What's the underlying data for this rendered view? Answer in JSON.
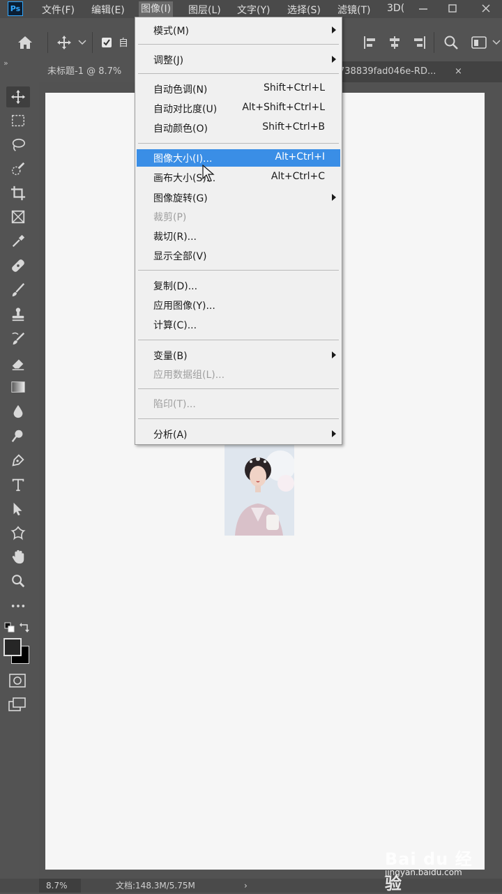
{
  "app": {
    "logo": "Ps"
  },
  "menubar": {
    "items": [
      "文件(F)",
      "编辑(E)",
      "图像(I)",
      "图层(L)",
      "文字(Y)",
      "选择(S)",
      "滤镜(T)",
      "3D("
    ],
    "active_index": 2
  },
  "optionsbar": {
    "auto_select_label": "自"
  },
  "tabs": [
    {
      "label": "未标题-1 @ 8.7%",
      "active": true
    },
    {
      "label": "738839fad046e-RD...",
      "active": false,
      "close": "×"
    }
  ],
  "image_menu": {
    "items": [
      {
        "label": "模式(M)",
        "shortcut": "",
        "submenu": true,
        "disabled": false
      },
      {
        "label": "调整(J)",
        "shortcut": "",
        "submenu": true,
        "disabled": false
      },
      {
        "label": "自动色调(N)",
        "shortcut": "Shift+Ctrl+L",
        "submenu": false,
        "disabled": false
      },
      {
        "label": "自动对比度(U)",
        "shortcut": "Alt+Shift+Ctrl+L",
        "submenu": false,
        "disabled": false
      },
      {
        "label": "自动颜色(O)",
        "shortcut": "Shift+Ctrl+B",
        "submenu": false,
        "disabled": false
      },
      {
        "label": "图像大小(I)...",
        "shortcut": "Alt+Ctrl+I",
        "submenu": false,
        "disabled": false,
        "highlighted": true
      },
      {
        "label": "画布大小(S)...",
        "shortcut": "Alt+Ctrl+C",
        "submenu": false,
        "disabled": false
      },
      {
        "label": "图像旋转(G)",
        "shortcut": "",
        "submenu": true,
        "disabled": false
      },
      {
        "label": "裁剪(P)",
        "shortcut": "",
        "submenu": false,
        "disabled": true
      },
      {
        "label": "裁切(R)...",
        "shortcut": "",
        "submenu": false,
        "disabled": false
      },
      {
        "label": "显示全部(V)",
        "shortcut": "",
        "submenu": false,
        "disabled": false
      },
      {
        "label": "复制(D)...",
        "shortcut": "",
        "submenu": false,
        "disabled": false
      },
      {
        "label": "应用图像(Y)...",
        "shortcut": "",
        "submenu": false,
        "disabled": false
      },
      {
        "label": "计算(C)...",
        "shortcut": "",
        "submenu": false,
        "disabled": false
      },
      {
        "label": "变量(B)",
        "shortcut": "",
        "submenu": true,
        "disabled": false
      },
      {
        "label": "应用数据组(L)...",
        "shortcut": "",
        "submenu": false,
        "disabled": true
      },
      {
        "label": "陷印(T)...",
        "shortcut": "",
        "submenu": false,
        "disabled": true
      },
      {
        "label": "分析(A)",
        "shortcut": "",
        "submenu": true,
        "disabled": false
      }
    ]
  },
  "status": {
    "zoom": "8.7%",
    "doc": "文档:148.3M/5.75M",
    "arrow": "›"
  },
  "watermark": {
    "logo": "Bai du 经验",
    "url": "jingyan.baidu.com"
  },
  "colors": {
    "highlight": "#3a8ee6",
    "menu_bg": "#f0f0f0",
    "ui_bg": "#535353",
    "canvas": "#f6f6f6"
  }
}
